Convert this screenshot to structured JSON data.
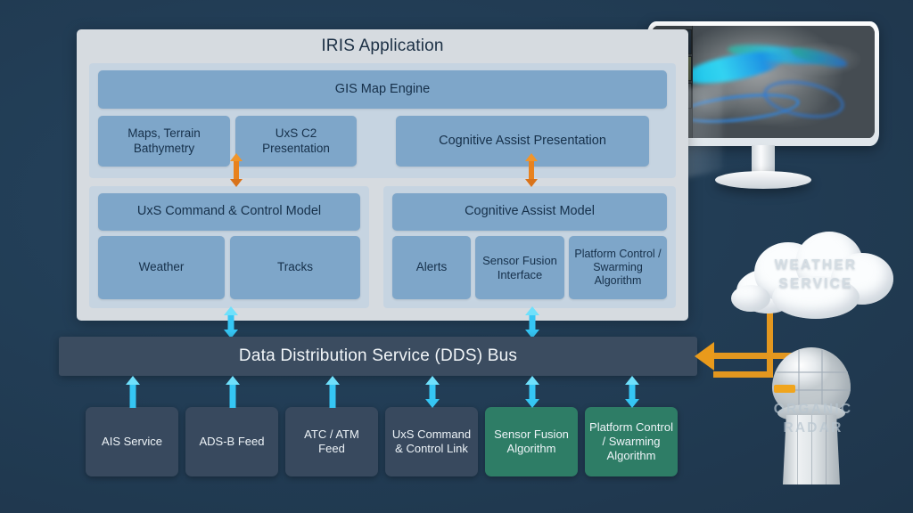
{
  "colors": {
    "background": "#23405a",
    "panel": "#d6dbe0",
    "group": "#c6d4e1",
    "box_blue": "#7ea6c9",
    "bus": "#3b4c60",
    "service_slate": "#38495e",
    "service_green": "#2e7d66",
    "arrow_cyan": "#35c6f4",
    "arrow_orange": "#e8821e"
  },
  "app": {
    "title": "IRIS Application",
    "gis_engine": "GIS Map Engine",
    "presentation": [
      {
        "label": "Maps, Terrain Bathymetry"
      },
      {
        "label": "UxS C2 Presentation"
      },
      {
        "label": "Cognitive Assist Presentation"
      }
    ],
    "models": {
      "left": {
        "header": "UxS Command & Control Model",
        "children": [
          {
            "label": "Weather"
          },
          {
            "label": "Tracks"
          }
        ]
      },
      "right": {
        "header": "Cognitive Assist Model",
        "children": [
          {
            "label": "Alerts"
          },
          {
            "label": "Sensor Fusion Interface"
          },
          {
            "label": "Platform Control / Swarming Algorithm"
          }
        ]
      }
    }
  },
  "bus": {
    "label": "Data Distribution Service (DDS) Bus"
  },
  "services": [
    {
      "label": "AIS Service",
      "style": "slate",
      "arrow": "up"
    },
    {
      "label": "ADS-B Feed",
      "style": "slate",
      "arrow": "up"
    },
    {
      "label": "ATC / ATM Feed",
      "style": "slate",
      "arrow": "up"
    },
    {
      "label": "UxS Command & Control Link",
      "style": "slate",
      "arrow": "both"
    },
    {
      "label": "Sensor Fusion Algorithm",
      "style": "green",
      "arrow": "both"
    },
    {
      "label": "Platform Control / Swarming Algorithm",
      "style": "green",
      "arrow": "both"
    }
  ],
  "external": {
    "weather_service": "WEATHER\nSERVICE",
    "weather_service_line1": "WEATHER",
    "weather_service_line2": "SERVICE",
    "organic_radar_line1": "ORGANIC",
    "organic_radar_line2": "RADAR"
  },
  "monitor": {
    "display_content": "gis-terrain-map"
  }
}
